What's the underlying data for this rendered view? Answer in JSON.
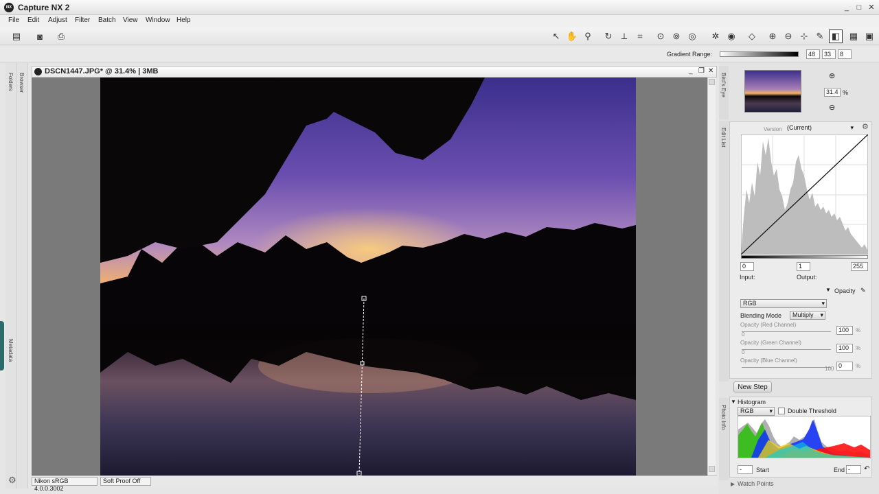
{
  "app": {
    "title": "Capture NX 2"
  },
  "menu": [
    "File",
    "Edit",
    "Adjust",
    "Filter",
    "Batch",
    "View",
    "Window",
    "Help"
  ],
  "toolbar": {
    "icons": [
      "direct-select-icon",
      "hand-icon",
      "zoom-icon",
      "rotate-icon",
      "straighten-icon",
      "crop-icon",
      "red-eye-icon",
      "auto-retouch-icon",
      "color-point-icon",
      "control-point-icon",
      "selection-control-point-icon",
      "lasso-icon",
      "brush-icon",
      "gradient-icon",
      "fill-icon"
    ]
  },
  "gradient": {
    "label": "Gradient Range:",
    "v1": "48",
    "v2": "33",
    "v3": "8"
  },
  "left_rail": {
    "folders": "Folders",
    "browser": "Browser",
    "metadata": "Metadata"
  },
  "document": {
    "title": "DSCN1447.JPG* @ 31.4% | 3MB"
  },
  "status": {
    "profile": "Nikon sRGB 4.0.0.3002",
    "proof": "Soft Proof Off"
  },
  "birds_eye": {
    "label": "Bird's Eye",
    "zoom": "31.4",
    "unit": "%"
  },
  "edit_list": {
    "label": "Edit List",
    "version_label": "Version",
    "version_value": "(Current)",
    "input_label": "Input:",
    "output_label": "Output:",
    "in_min": "0",
    "in_mid": "1",
    "in_max": "255",
    "opacity_label": "Opacity",
    "channel": "RGB",
    "blending_label": "Blending Mode",
    "blending_value": "Multiply",
    "red_label": "Opacity (Red Channel)",
    "red_val": "100",
    "red_min": "0",
    "red_max": "100",
    "green_label": "Opacity (Green Channel)",
    "green_val": "100",
    "green_min": "0",
    "green_max": "100",
    "blue_label": "Opacity (Blue Channel)",
    "blue_val": "0",
    "blue_min": "0",
    "blue_max": "100",
    "pct": "%",
    "new_step": "New Step"
  },
  "photo_info": {
    "label": "Photo Info",
    "histogram_label": "Histogram",
    "channel": "RGB",
    "double_threshold": "Double Threshold",
    "start_label": "Start",
    "end_label": "End",
    "start_val": "-",
    "end_val": "-"
  },
  "watch_points": {
    "label": "Watch Points"
  },
  "colors": {
    "accent": "#1f1f1f",
    "sky_top": "#3a3aa0",
    "sunset": "#f5a84a"
  }
}
